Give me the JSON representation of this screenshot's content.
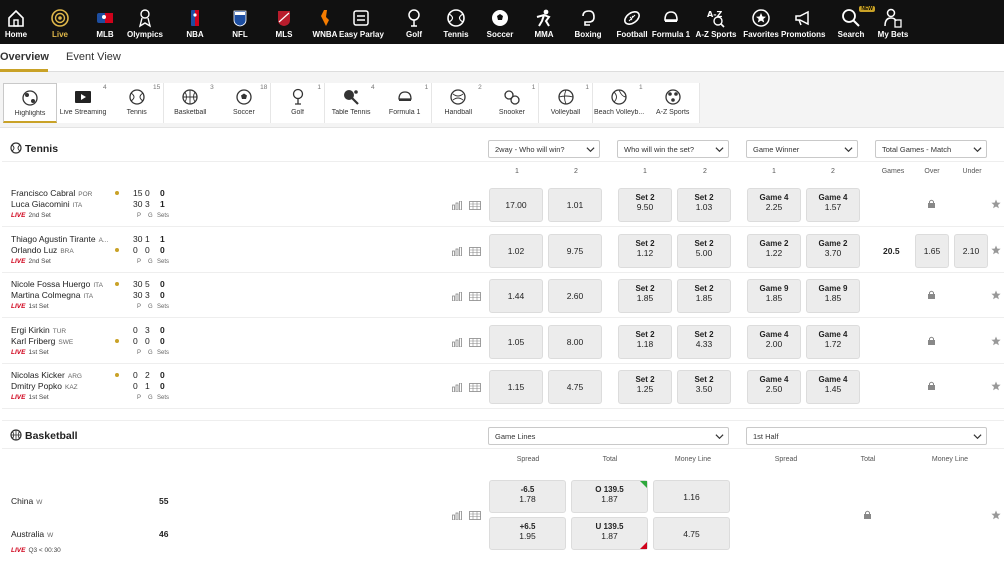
{
  "nav": [
    {
      "label": "Home",
      "icon": "home-icon"
    },
    {
      "label": "Live",
      "icon": "live-icon",
      "active": true
    },
    {
      "label": "MLB",
      "icon": "mlb-icon"
    },
    {
      "label": "Olympics",
      "icon": "olympics-icon"
    },
    {
      "label": "NBA",
      "icon": "nba-icon"
    },
    {
      "label": "NFL",
      "icon": "nfl-icon"
    },
    {
      "label": "MLS",
      "icon": "mls-icon"
    },
    {
      "label": "WNBA",
      "icon": "wnba-icon"
    },
    {
      "label": "Easy Parlay",
      "icon": "easy-parlay-icon"
    },
    {
      "label": "Golf",
      "icon": "golf-icon"
    },
    {
      "label": "Tennis",
      "icon": "tennis-icon"
    },
    {
      "label": "Soccer",
      "icon": "soccer-icon"
    },
    {
      "label": "MMA",
      "icon": "mma-icon"
    },
    {
      "label": "Boxing",
      "icon": "boxing-icon"
    },
    {
      "label": "Football",
      "icon": "football-icon"
    },
    {
      "label": "Formula 1",
      "icon": "formula1-icon"
    },
    {
      "label": "A-Z Sports",
      "icon": "az-sports-icon"
    },
    {
      "label": "Favorites",
      "icon": "star-icon"
    },
    {
      "label": "Promotions",
      "icon": "megaphone-icon"
    },
    {
      "label": "Search",
      "icon": "search-icon",
      "badge": "NEW"
    },
    {
      "label": "My Bets",
      "icon": "my-bets-icon"
    }
  ],
  "tabs": [
    {
      "label": "Overview",
      "active": true
    },
    {
      "label": "Event View"
    }
  ],
  "filters": [
    {
      "label": "Highlights",
      "count": "",
      "icon": "highlights-icon"
    },
    {
      "label": "Live Streaming",
      "count": "4",
      "icon": "play-icon"
    },
    {
      "label": "Tennis",
      "count": "15",
      "icon": "tennis-icon"
    },
    {
      "label": "Basketball",
      "count": "3",
      "icon": "basketball-icon"
    },
    {
      "label": "Soccer",
      "count": "18",
      "icon": "soccer-icon"
    },
    {
      "label": "Golf",
      "count": "1",
      "icon": "golf-icon"
    },
    {
      "label": "Table Tennis",
      "count": "4",
      "icon": "table-tennis-icon"
    },
    {
      "label": "Formula 1",
      "count": "1",
      "icon": "formula1-icon"
    },
    {
      "label": "Handball",
      "count": "2",
      "icon": "handball-icon"
    },
    {
      "label": "Snooker",
      "count": "1",
      "icon": "snooker-icon"
    },
    {
      "label": "Volleyball",
      "count": "1",
      "icon": "volleyball-icon"
    },
    {
      "label": "Beach Volleyb...",
      "count": "1",
      "icon": "beach-volleyball-icon"
    },
    {
      "label": "A-Z Sports",
      "count": "",
      "icon": "az-sports-icon"
    }
  ],
  "tennis": {
    "title": "Tennis",
    "selects": [
      "2way - Who will win?",
      "Who will win the set?",
      "Game Winner",
      "Total Games - Match"
    ],
    "col_headers": [
      "1",
      "2",
      "1",
      "2",
      "1",
      "2",
      "Games",
      "Over",
      "Under"
    ],
    "score_labels": [
      "P",
      "G",
      "Sets"
    ],
    "matches": [
      {
        "p1": "Francisco Cabral",
        "c1": "POR",
        "p2": "Luca Giacomini",
        "c2": "ITA",
        "s1": [
          "15",
          "0",
          "0"
        ],
        "s2": [
          "30",
          "3",
          "1"
        ],
        "serve": 1,
        "live": "LIVE",
        "period": "2nd Set",
        "win": [
          "17.00",
          "1.01"
        ],
        "set": [
          {
            "t": "Set 2",
            "v": "9.50"
          },
          {
            "t": "Set 2",
            "v": "1.03"
          }
        ],
        "game": [
          {
            "t": "Game 4",
            "v": "2.25"
          },
          {
            "t": "Game 4",
            "v": "1.57"
          }
        ],
        "total": null
      },
      {
        "p1": "Thiago Agustin Tirante",
        "c1": "A...",
        "p2": "Orlando Luz",
        "c2": "BRA",
        "s1": [
          "30",
          "1",
          "1"
        ],
        "s2": [
          "0",
          "0",
          "0"
        ],
        "serve": 2,
        "live": "LIVE",
        "period": "2nd Set",
        "win": [
          "1.02",
          "9.75"
        ],
        "set": [
          {
            "t": "Set 2",
            "v": "1.12"
          },
          {
            "t": "Set 2",
            "v": "5.00"
          }
        ],
        "game": [
          {
            "t": "Game 2",
            "v": "1.22"
          },
          {
            "t": "Game 2",
            "v": "3.70"
          }
        ],
        "total": {
          "games": "20.5",
          "over": "1.65",
          "under": "2.10"
        }
      },
      {
        "p1": "Nicole Fossa Huergo",
        "c1": "ITA",
        "p2": "Martina Colmegna",
        "c2": "ITA",
        "s1": [
          "30",
          "5",
          "0"
        ],
        "s2": [
          "30",
          "3",
          "0"
        ],
        "serve": 1,
        "live": "LIVE",
        "period": "1st Set",
        "win": [
          "1.44",
          "2.60"
        ],
        "set": [
          {
            "t": "Set 2",
            "v": "1.85"
          },
          {
            "t": "Set 2",
            "v": "1.85"
          }
        ],
        "game": [
          {
            "t": "Game 9",
            "v": "1.85"
          },
          {
            "t": "Game 9",
            "v": "1.85"
          }
        ],
        "total": null
      },
      {
        "p1": "Ergi Kirkin",
        "c1": "TUR",
        "p2": "Karl Friberg",
        "c2": "SWE",
        "s1": [
          "0",
          "3",
          "0"
        ],
        "s2": [
          "0",
          "0",
          "0"
        ],
        "serve": 2,
        "live": "LIVE",
        "period": "1st Set",
        "win": [
          "1.05",
          "8.00"
        ],
        "set": [
          {
            "t": "Set 2",
            "v": "1.18"
          },
          {
            "t": "Set 2",
            "v": "4.33"
          }
        ],
        "game": [
          {
            "t": "Game 4",
            "v": "2.00"
          },
          {
            "t": "Game 4",
            "v": "1.72"
          }
        ],
        "total": null
      },
      {
        "p1": "Nicolas Kicker",
        "c1": "ARG",
        "p2": "Dmitry Popko",
        "c2": "KAZ",
        "s1": [
          "0",
          "2",
          "0"
        ],
        "s2": [
          "0",
          "1",
          "0"
        ],
        "serve": 1,
        "live": "LIVE",
        "period": "1st Set",
        "win": [
          "1.15",
          "4.75"
        ],
        "set": [
          {
            "t": "Set 2",
            "v": "1.25"
          },
          {
            "t": "Set 2",
            "v": "3.50"
          }
        ],
        "game": [
          {
            "t": "Game 4",
            "v": "2.50"
          },
          {
            "t": "Game 4",
            "v": "1.45"
          }
        ],
        "total": null
      }
    ]
  },
  "basketball": {
    "title": "Basketball",
    "selects": [
      "Game Lines",
      "1st Half"
    ],
    "col_headers": [
      "Spread",
      "Total",
      "Money Line",
      "Spread",
      "Total",
      "Money Line"
    ],
    "team1": "China",
    "team1_tag": "W",
    "score1": "55",
    "team2": "Australia",
    "team2_tag": "W",
    "score2": "46",
    "live": "LIVE",
    "period": "Q3 < 00:30",
    "spread": [
      {
        "t": "-6.5",
        "v": "1.78"
      },
      {
        "t": "+6.5",
        "v": "1.95"
      }
    ],
    "total": [
      {
        "t": "O 139.5",
        "v": "1.87"
      },
      {
        "t": "U 139.5",
        "v": "1.87"
      }
    ],
    "moneyline": [
      "1.16",
      "4.75"
    ]
  }
}
